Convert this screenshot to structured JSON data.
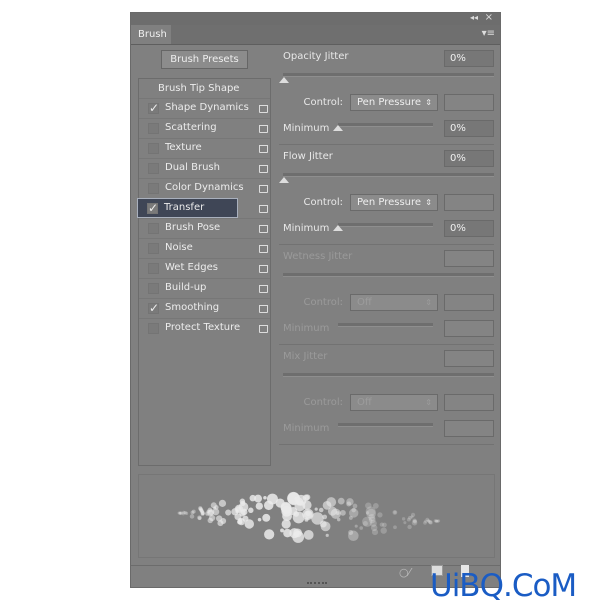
{
  "panel": {
    "tab": "Brush",
    "collapse_icon": "double-chevron-left",
    "close_icon": "x",
    "menu_icon": "panel-menu"
  },
  "presets_button": "Brush Presets",
  "list": {
    "header": "Brush Tip Shape",
    "items": [
      {
        "label": "Shape Dynamics",
        "checked": true
      },
      {
        "label": "Scattering",
        "checked": false
      },
      {
        "label": "Texture",
        "checked": false
      },
      {
        "label": "Dual Brush",
        "checked": false
      },
      {
        "label": "Color Dynamics",
        "checked": false
      },
      {
        "label": "Transfer",
        "checked": true,
        "selected": true
      },
      {
        "label": "Brush Pose",
        "checked": false
      },
      {
        "label": "Noise",
        "checked": false
      },
      {
        "label": "Wet Edges",
        "checked": false
      },
      {
        "label": "Build-up",
        "checked": false
      },
      {
        "label": "Smoothing",
        "checked": true
      },
      {
        "label": "Protect Texture",
        "checked": false
      }
    ]
  },
  "check": "✓",
  "lock": "🔓",
  "sections": [
    {
      "title": "Opacity Jitter",
      "value": "0%",
      "control_label": "Control:",
      "control": "Pen Pressure",
      "minimum_label": "Minimum",
      "minimum": "0%",
      "enabled": true
    },
    {
      "title": "Flow Jitter",
      "value": "0%",
      "control_label": "Control:",
      "control": "Pen Pressure",
      "minimum_label": "Minimum",
      "minimum": "0%",
      "enabled": true
    },
    {
      "title": "Wetness Jitter",
      "value": "",
      "control_label": "Control:",
      "control": "Off",
      "minimum_label": "Minimum",
      "minimum": "",
      "enabled": false
    },
    {
      "title": "Mix Jitter",
      "value": "",
      "control_label": "Control:",
      "control": "Off",
      "minimum_label": "Minimum",
      "minimum": "",
      "enabled": false
    }
  ],
  "footer_icons": [
    "toggle-live-tip-icon",
    "grid-icon",
    "new-preset-icon"
  ],
  "watermark": "UiBQ.CoM"
}
